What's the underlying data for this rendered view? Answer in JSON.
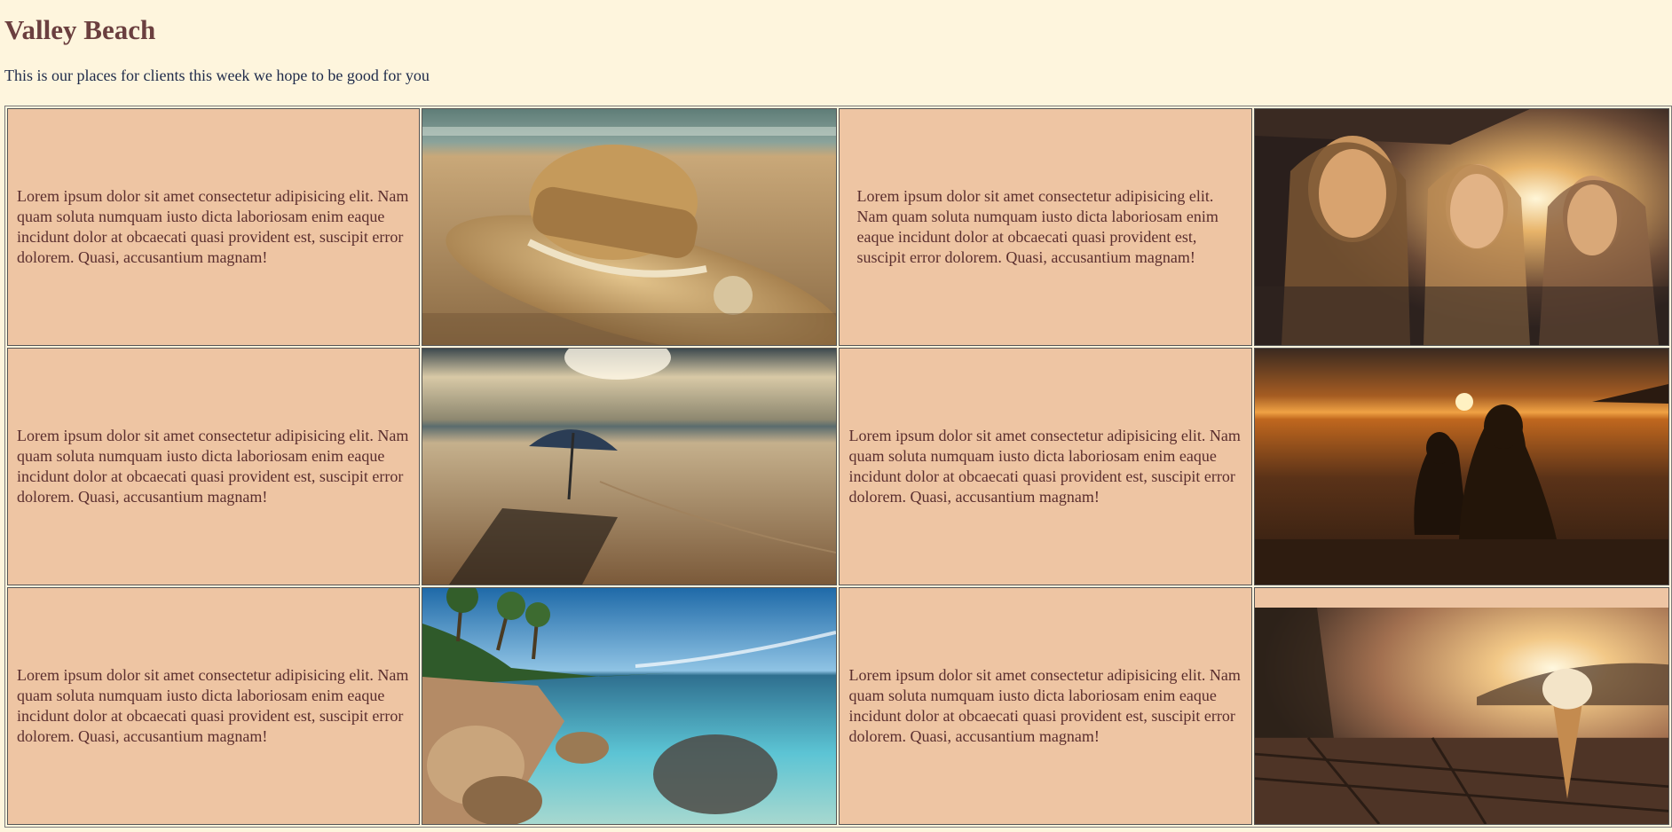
{
  "page": {
    "title": "Valley Beach",
    "subtitle": "This is our places for clients this week we hope to be good for you"
  },
  "grid": {
    "rows": [
      {
        "text1": "Lorem ipsum dolor sit amet consectetur adipisicing elit. Nam quam soluta numquam iusto dicta laboriosam enim eaque incidunt dolor at obcaecati quasi provident est, suscipit error dolorem. Quasi, accusantium magnam!",
        "image1": "straw hat on beach sand",
        "text2": "Lorem ipsum dolor sit amet consectetur adipisicing elit. Nam quam soluta numquam iusto dicta laboriosam enim eaque incidunt dolor at obcaecati quasi provident est, suscipit error dolorem. Quasi, accusantium magnam!",
        "image2": "three smiling women at sunset"
      },
      {
        "text1": "Lorem ipsum dolor sit amet consectetur adipisicing elit. Nam quam soluta numquam iusto dicta laboriosam enim eaque incidunt dolor at obcaecati quasi provident est, suscipit error dolorem. Quasi, accusantium magnam!",
        "image1": "beach umbrella on empty beach",
        "text2": "Lorem ipsum dolor sit amet consectetur adipisicing elit. Nam quam soluta numquam iusto dicta laboriosam enim eaque incidunt dolor at obcaecati quasi provident est, suscipit error dolorem. Quasi, accusantium magnam!",
        "image2": "mother and child silhouette at sunset beach"
      },
      {
        "text1": "Lorem ipsum dolor sit amet consectetur adipisicing elit. Nam quam soluta numquam iusto dicta laboriosam enim eaque incidunt dolor at obcaecati quasi provident est, suscipit error dolorem. Quasi, accusantium magnam!",
        "image1": "tropical rocky lagoon with palms",
        "text2": "Lorem ipsum dolor sit amet consectetur adipisicing elit. Nam quam soluta numquam iusto dicta laboriosam enim eaque incidunt dolor at obcaecati quasi provident est, suscipit error dolorem. Quasi, accusantium magnam!",
        "image2": "ice cream cone on pier at sunset"
      }
    ]
  }
}
